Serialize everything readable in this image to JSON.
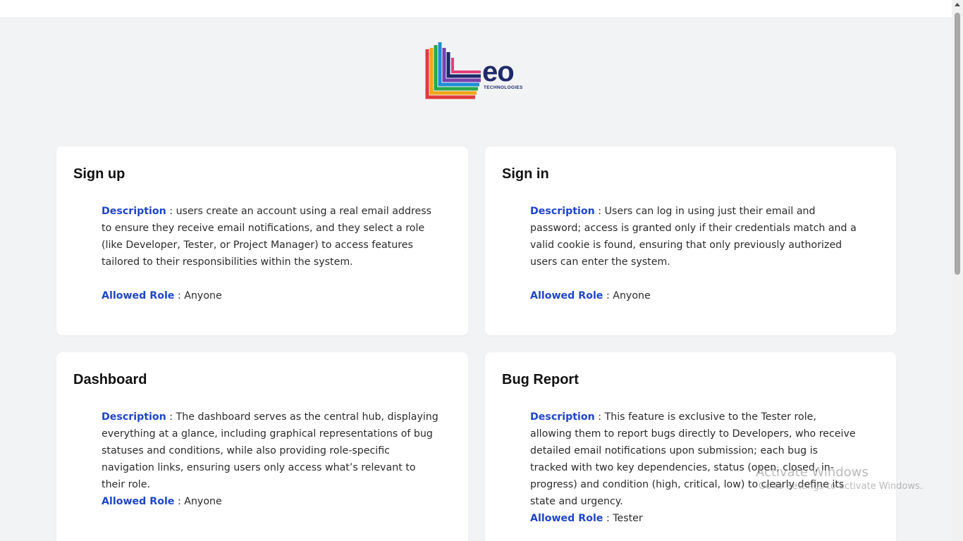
{
  "logo": {
    "word": "eo",
    "subtitle": "TECHNOLOGIES"
  },
  "cards": [
    {
      "title": "Sign up",
      "description_label": "Description",
      "description": " : users create an account using a real email address to ensure they receive email notifications, and they select a role (like Developer, Tester, or Project Manager) to access features tailored to their responsibilities within the system.",
      "role_label": "Allowed Role",
      "role": " : Anyone"
    },
    {
      "title": "Sign in",
      "description_label": "Description",
      "description": " : Users can log in using just their email and password; access is granted only if their credentials match and a valid cookie is found, ensuring that only previously authorized users can enter the system.",
      "role_label": "Allowed Role",
      "role": " : Anyone"
    },
    {
      "title": "Dashboard",
      "description_label": "Description",
      "description": " : The dashboard serves as the central hub, displaying everything at a glance, including graphical representations of bug statuses and conditions, while also providing role-specific navigation links, ensuring users only access what’s relevant to their role.",
      "role_label": "Allowed Role",
      "role": " : Anyone"
    },
    {
      "title": "Bug Report",
      "description_label": "Description",
      "description": " : This feature is exclusive to the Tester role, allowing them to report bugs directly to Developers, who receive detailed email notifications upon submission; each bug is tracked with two key dependencies, status (open, closed, in-progress) and condition (high, critical, low) to clearly define its state and urgency.",
      "role_label": "Allowed Role",
      "role": " : Tester"
    }
  ],
  "watermark": {
    "line1": "Activate Windows",
    "line2": "Go to Settings to activate Windows."
  },
  "colors": {
    "accent": "#1f46c8",
    "background": "#f2f3f5",
    "card": "#ffffff"
  }
}
